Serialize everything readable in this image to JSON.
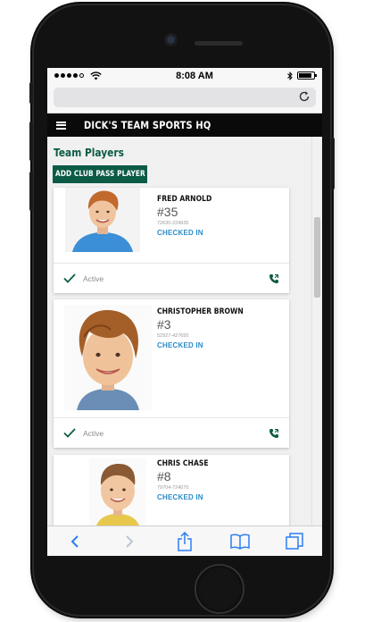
{
  "status_bar": {
    "time": "8:08 AM",
    "battery_level": 0.9
  },
  "app": {
    "brand": "DICK'S TEAM SPORTS HQ"
  },
  "page": {
    "title": "Team Players",
    "add_button": "ADD CLUB PASS PLAYER"
  },
  "players": [
    {
      "name": "FRED ARNOLD",
      "number": "#35",
      "id": "72630-224935",
      "status": "CHECKED IN",
      "active": "Active"
    },
    {
      "name": "CHRISTOPHER BROWN",
      "number": "#3",
      "id": "52927-427650",
      "status": "CHECKED IN",
      "active": "Active"
    },
    {
      "name": "CHRIS CHASE",
      "number": "#8",
      "id": "79704-724070",
      "status": "CHECKED IN"
    }
  ],
  "colors": {
    "brand_green": "#0b5b46",
    "link_blue": "#2a8ccb",
    "header_black": "#0a0a0a"
  },
  "icons": {
    "toolbar": [
      "back-icon",
      "forward-icon",
      "share-icon",
      "bookmarks-icon",
      "tabs-icon"
    ],
    "card": [
      "checkmark-icon",
      "phone-icon"
    ],
    "browser": [
      "reload-icon"
    ]
  }
}
